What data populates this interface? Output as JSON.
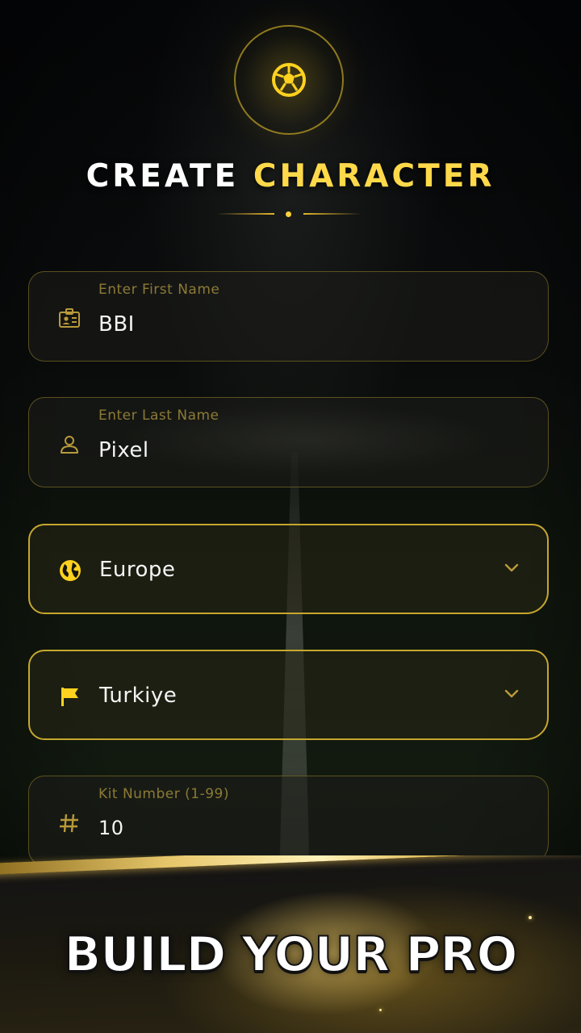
{
  "header": {
    "logo_icon": "soccer-ball-icon",
    "title_part1": "CREATE",
    "title_part2": "CHARACTER"
  },
  "form": {
    "first_name": {
      "label": "Enter First Name",
      "value": "BBI",
      "icon": "id-card-icon"
    },
    "last_name": {
      "label": "Enter Last Name",
      "value": "Pixel",
      "icon": "person-icon"
    },
    "region": {
      "value": "Europe",
      "icon": "globe-icon"
    },
    "country": {
      "value": "Turkiye",
      "icon": "flag-icon"
    },
    "kit_number": {
      "label": "Kit Number (1-99)",
      "value": "10",
      "icon": "hash-icon"
    }
  },
  "banner": {
    "tagline": "BUILD YOUR PRO"
  },
  "colors": {
    "accent_gold": "#ffd94a",
    "label_gold": "#8c7a36",
    "background": "#050607"
  }
}
